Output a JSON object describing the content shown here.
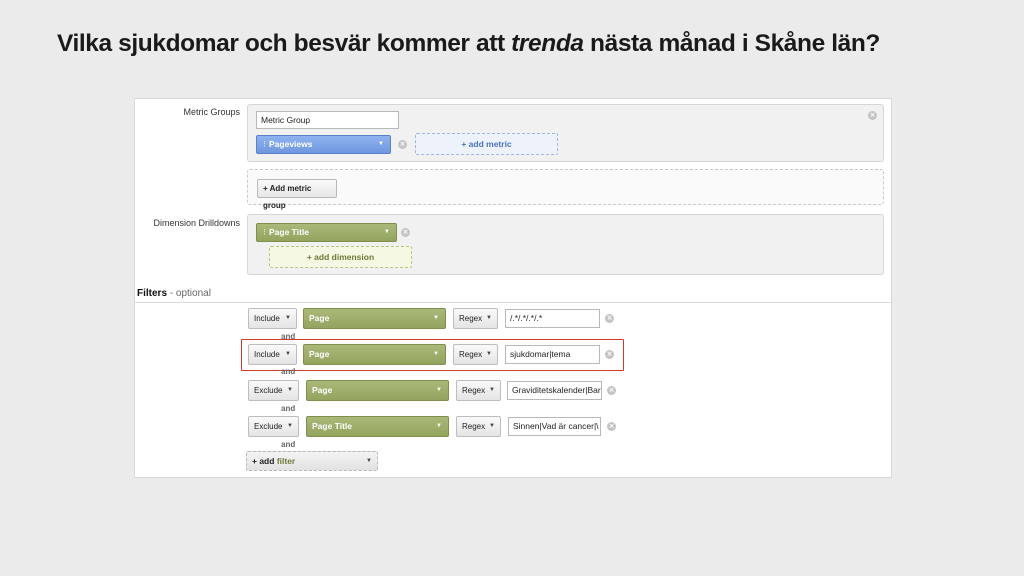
{
  "title": {
    "part1": "Vilka sjukdomar och besvär kommer att ",
    "emphasis": "trenda",
    "part2": " nästa månad i Skåne län?"
  },
  "metric_groups": {
    "label": "Metric Groups",
    "group_name_value": "Metric Group",
    "metric_pill": "Pageviews",
    "add_metric": "+ add metric",
    "add_group_button": "+ Add metric group"
  },
  "dimensions": {
    "label": "Dimension Drilldowns",
    "dimension_pill": "Page Title",
    "add_dimension": "+ add dimension"
  },
  "filters": {
    "title": "Filters",
    "subtitle": "- optional",
    "and_label": "and",
    "rows": [
      {
        "mode": "Include",
        "dimension": "Page",
        "match": "Regex",
        "value": "/.*/.*/.*/.*"
      },
      {
        "mode": "Include",
        "dimension": "Page",
        "match": "Regex",
        "value": "sjukdomar|tema"
      },
      {
        "mode": "Exclude",
        "dimension": "Page",
        "match": "Regex",
        "value": "Graviditetskalender|Bar"
      },
      {
        "mode": "Exclude",
        "dimension": "Page Title",
        "match": "Regex",
        "value": "Sinnen|Vad är cancer|\\"
      }
    ],
    "add_filter_prefix": "+ add",
    "add_filter_word": "filter"
  },
  "colors": {
    "blue_pill": "#7aa0e6",
    "green_pill": "#9bac67",
    "highlight": "#d33a2c"
  },
  "icons": [
    "close-icon",
    "chevron-down-icon",
    "drag-handle-icon"
  ]
}
